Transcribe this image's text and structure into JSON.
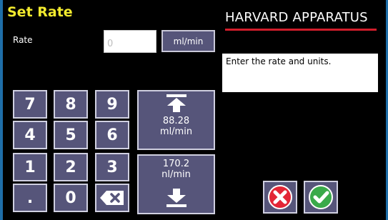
{
  "header": {
    "title": "Set Rate",
    "brand": "HARVARD APPARATUS"
  },
  "rate": {
    "label": "Rate",
    "value": "0",
    "unit_button_label": "ml/min"
  },
  "message": "Enter the rate and units.",
  "keypad": {
    "keys": [
      "7",
      "8",
      "9",
      "4",
      "5",
      "6",
      "1",
      "2",
      "3",
      ".",
      "0"
    ],
    "backspace_icon": "backspace-icon"
  },
  "limits": {
    "max_value": "88.28",
    "max_unit": "ml/min",
    "min_value": "170.2",
    "min_unit": "nl/min"
  },
  "colors": {
    "title": "#f2ea2e",
    "brand_underline": "#d21d2b",
    "button_fill": "#56557a",
    "cancel": "#e32636",
    "confirm": "#3aaa4a"
  }
}
